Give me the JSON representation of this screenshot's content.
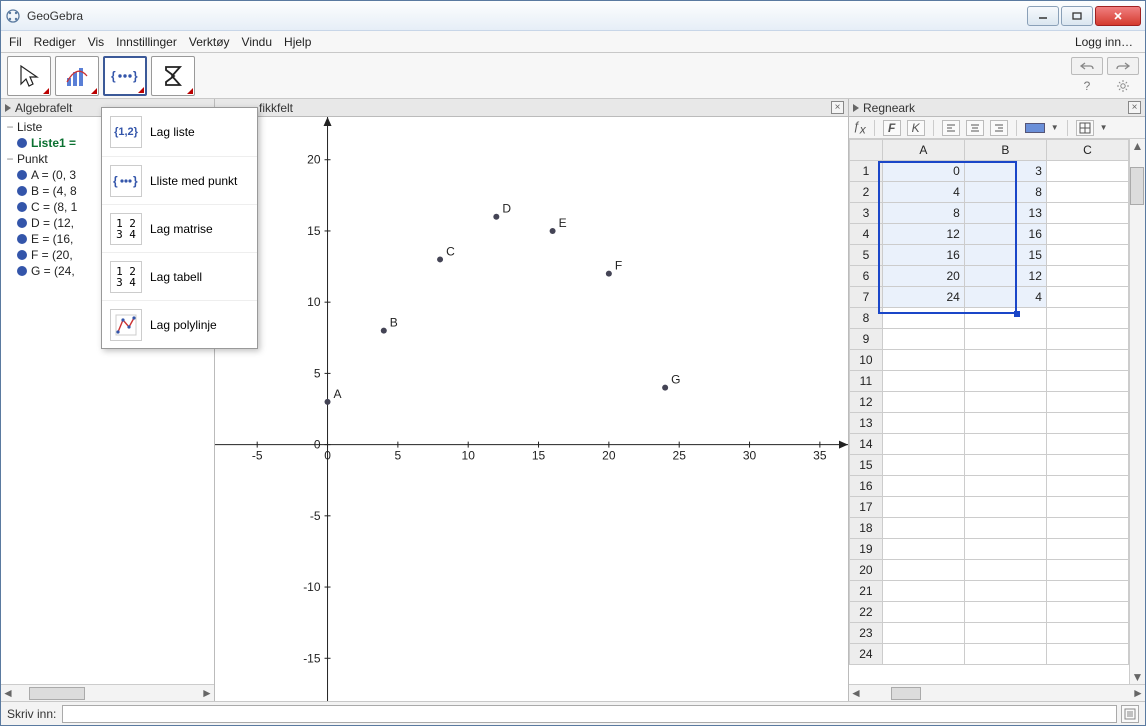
{
  "window": {
    "title": "GeoGebra"
  },
  "menu": {
    "items": [
      "Fil",
      "Rediger",
      "Vis",
      "Innstillinger",
      "Verktøy",
      "Vindu",
      "Hjelp"
    ],
    "login": "Logg inn…"
  },
  "dropdown": {
    "items": [
      {
        "icon": "{1,2}",
        "label": "Lag liste"
      },
      {
        "icon": "•••",
        "label": "Lliste med punkt"
      },
      {
        "icon": "1 2\n3 4",
        "label": "Lag matrise"
      },
      {
        "icon": "1 2\n3 4",
        "label": "Lag tabell"
      },
      {
        "icon": "poly",
        "label": "Lag polylinje"
      }
    ]
  },
  "algebra": {
    "title": "Algebrafelt",
    "groups": [
      {
        "name": "Liste",
        "items": [
          {
            "label": "Liste1 =",
            "bold": true
          }
        ]
      },
      {
        "name": "Punkt",
        "items": [
          {
            "label": "A = (0, 3"
          },
          {
            "label": "B = (4, 8"
          },
          {
            "label": "C = (8, 1"
          },
          {
            "label": "D = (12,"
          },
          {
            "label": "E = (16,"
          },
          {
            "label": "F = (20,"
          },
          {
            "label": "G = (24,"
          }
        ]
      }
    ]
  },
  "graphics": {
    "title": "fikkfelt"
  },
  "spreadsheet": {
    "title": "Regneark",
    "columns": [
      "A",
      "B",
      "C"
    ],
    "rows": 24,
    "selection": {
      "r1": 1,
      "c1": 1,
      "r2": 7,
      "c2": 2
    },
    "data": {
      "1": {
        "A": "0",
        "B": "3"
      },
      "2": {
        "A": "4",
        "B": "8"
      },
      "3": {
        "A": "8",
        "B": "13"
      },
      "4": {
        "A": "12",
        "B": "16"
      },
      "5": {
        "A": "16",
        "B": "15"
      },
      "6": {
        "A": "20",
        "B": "12"
      },
      "7": {
        "A": "24",
        "B": "4"
      }
    }
  },
  "inputbar": {
    "label": "Skriv inn:"
  },
  "chart_data": {
    "type": "scatter",
    "title": "",
    "xlabel": "",
    "ylabel": "",
    "xlim": [
      -8,
      37
    ],
    "ylim": [
      -18,
      23
    ],
    "xticks": [
      -5,
      0,
      5,
      10,
      15,
      20,
      25,
      30,
      35
    ],
    "yticks": [
      -15,
      -10,
      -5,
      0,
      5,
      10,
      15,
      20
    ],
    "series": [
      {
        "name": "points",
        "points": [
          {
            "label": "A",
            "x": 0,
            "y": 3
          },
          {
            "label": "B",
            "x": 4,
            "y": 8
          },
          {
            "label": "C",
            "x": 8,
            "y": 13
          },
          {
            "label": "D",
            "x": 12,
            "y": 16
          },
          {
            "label": "E",
            "x": 16,
            "y": 15
          },
          {
            "label": "F",
            "x": 20,
            "y": 12
          },
          {
            "label": "G",
            "x": 24,
            "y": 4
          }
        ]
      }
    ]
  }
}
